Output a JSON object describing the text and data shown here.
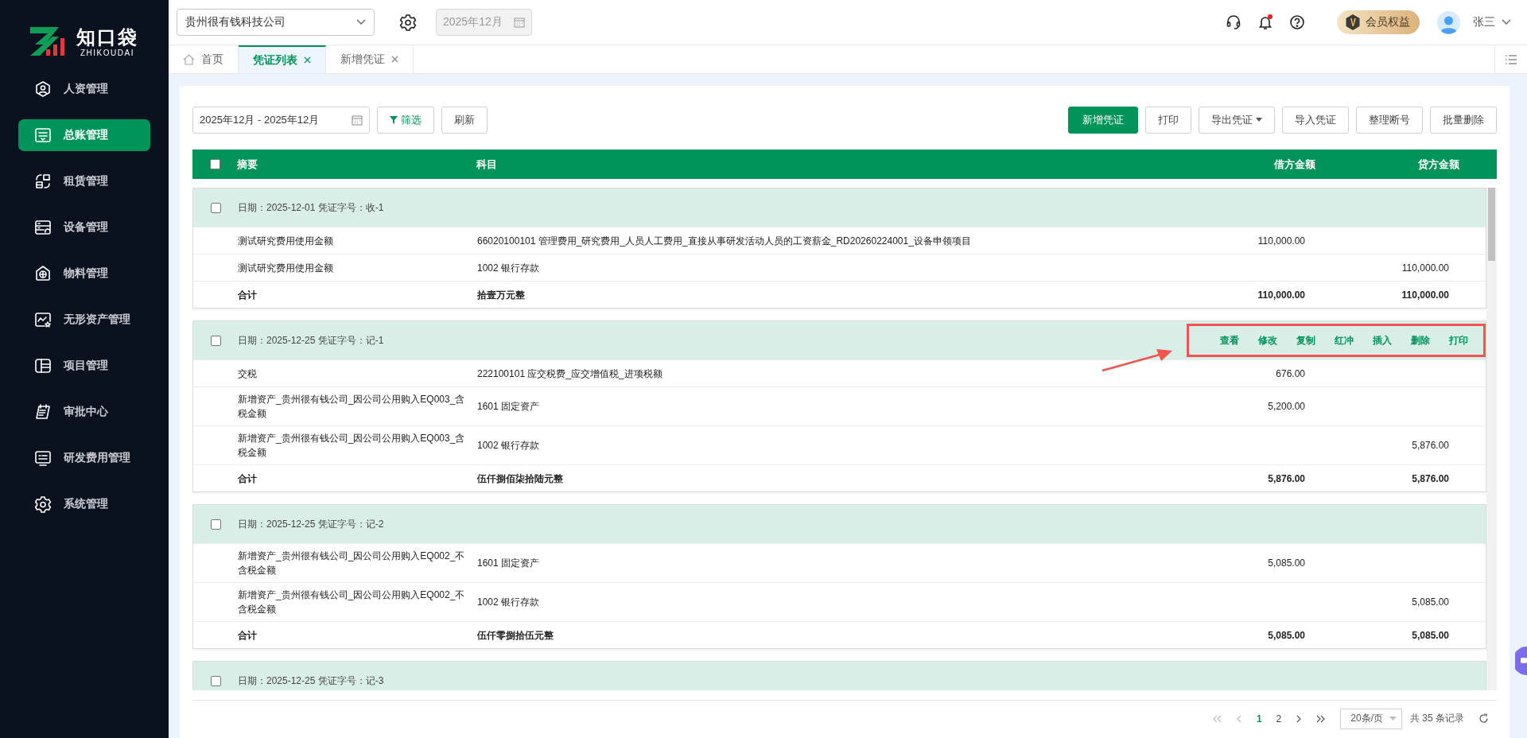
{
  "logo": {
    "name": "知口袋",
    "subtitle": "ZHIKOUDAI"
  },
  "sidebar": {
    "items": [
      {
        "label": "人资管理",
        "selected": false
      },
      {
        "label": "总账管理",
        "selected": true
      },
      {
        "label": "租赁管理",
        "selected": false
      },
      {
        "label": "设备管理",
        "selected": false
      },
      {
        "label": "物料管理",
        "selected": false
      },
      {
        "label": "无形资产管理",
        "selected": false
      },
      {
        "label": "项目管理",
        "selected": false
      },
      {
        "label": "审批中心",
        "selected": false
      },
      {
        "label": "研发费用管理",
        "selected": false
      },
      {
        "label": "系统管理",
        "selected": false
      }
    ]
  },
  "header": {
    "company": "贵州很有钱科技公司",
    "period": "2025年12月",
    "unread": true,
    "member": "会员权益",
    "user": "张三"
  },
  "tabs": [
    {
      "label": "首页",
      "kind": "home",
      "selected": false
    },
    {
      "label": "凭证列表",
      "kind": "closable",
      "selected": true
    },
    {
      "label": "新增凭证",
      "kind": "closable",
      "selected": false
    }
  ],
  "toolbar": {
    "date_range": "2025年12月 - 2025年12月",
    "filter": "筛选",
    "refresh": "刷新",
    "actions": [
      {
        "label": "新增凭证",
        "primary": true,
        "dropdown": false
      },
      {
        "label": "打印",
        "primary": false,
        "dropdown": false
      },
      {
        "label": "导出凭证",
        "primary": false,
        "dropdown": true
      },
      {
        "label": "导入凭证",
        "primary": false,
        "dropdown": false
      },
      {
        "label": "整理断号",
        "primary": false,
        "dropdown": false
      },
      {
        "label": "批量删除",
        "primary": false,
        "dropdown": false
      }
    ]
  },
  "table": {
    "all_checked": false,
    "columns": [
      "摘要",
      "科目",
      "借方金额",
      "贷方金额"
    ],
    "vouchers": [
      {
        "header": "日期：2025-12-01 凭证字号：收-1",
        "checked": false,
        "highlighted": false,
        "entries": [
          {
            "summary": "测试研究费用使用金额",
            "account": "66020100101 管理费用_研究费用_人员人工费用_直接从事研发活动人员的工资薪金_RD20260224001_设备申领项目",
            "debit": "110,000.00"
          },
          {
            "summary": "测试研究费用使用金额",
            "account": "1002 银行存款",
            "credit": "110,000.00"
          }
        ],
        "total": {
          "label": "合计",
          "words": "拾壹万元整",
          "debit": "110,000.00",
          "credit": "110,000.00"
        }
      },
      {
        "header": "日期：2025-12-25 凭证字号：记-1",
        "checked": false,
        "highlighted": true,
        "actions": [
          "查看",
          "修改",
          "复制",
          "红冲",
          "插入",
          "删除",
          "打印"
        ],
        "entries": [
          {
            "summary": "交税",
            "account": "222100101 应交税费_应交增值税_进项税额",
            "debit": "676.00"
          },
          {
            "summary": "新增资产_贵州很有钱公司_因公司公用购入EQ003_含税金额",
            "account": "1601 固定资产",
            "debit": "5,200.00"
          },
          {
            "summary": "新增资产_贵州很有钱公司_因公司公用购入EQ003_含税金额",
            "account": "1002 银行存款",
            "credit": "5,876.00"
          }
        ],
        "total": {
          "label": "合计",
          "words": "伍仟捌佰柒拾陆元整",
          "debit": "5,876.00",
          "credit": "5,876.00"
        }
      },
      {
        "header": "日期：2025-12-25 凭证字号：记-2",
        "checked": false,
        "highlighted": false,
        "entries": [
          {
            "summary": "新增资产_贵州很有钱公司_因公司公用购入EQ002_不含税金额",
            "account": "1601 固定资产",
            "debit": "5,085.00"
          },
          {
            "summary": "新增资产_贵州很有钱公司_因公司公用购入EQ002_不含税金额",
            "account": "1002 银行存款",
            "credit": "5,085.00"
          }
        ],
        "total": {
          "label": "合计",
          "words": "伍仟零捌拾伍元整",
          "debit": "5,085.00",
          "credit": "5,085.00"
        }
      },
      {
        "header": "日期：2025-12-25 凭证字号：记-3",
        "checked": false,
        "highlighted": false
      }
    ]
  },
  "pagination": {
    "pages": [
      {
        "label": "1",
        "selected": true
      },
      {
        "label": "2",
        "selected": false
      }
    ],
    "page_size": "20条/页",
    "total": "共 35 条记录"
  }
}
